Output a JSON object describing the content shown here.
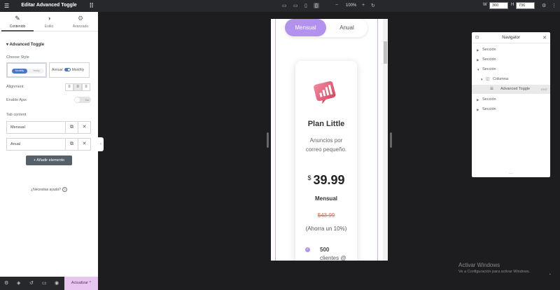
{
  "panel": {
    "title": "Editar Advanced Toggle",
    "tabs": [
      {
        "label": "Contenido",
        "icon": "pencil-icon"
      },
      {
        "label": "Estilo",
        "icon": "half-circle-icon"
      },
      {
        "label": "Avanzado",
        "icon": "gear-icon"
      }
    ],
    "section_title": "Advanced Toggle",
    "choose_style_label": "Choose Style",
    "style_option_1": {
      "on": "Monthly",
      "off": "Yearly"
    },
    "style_option_2": {
      "left": "Annual",
      "right": "Monthly"
    },
    "alignment_label": "Alignment",
    "enable_ajax_label": "Enable Ajax",
    "ajax_value": "No",
    "tab_content_label": "Tab content",
    "tab_items": [
      "Mensual",
      "Anual"
    ],
    "add_button": "Añadir elemento",
    "help_text": "¿Necesitas ayuda?",
    "update_button": "Actualizar"
  },
  "toolbar": {
    "zoom": "100%",
    "width_label": "W",
    "width_value": "360",
    "height_label": "H",
    "height_value": "736"
  },
  "preview": {
    "toggle": [
      "Mensual",
      "Anual"
    ],
    "plan_name": "Plan Little",
    "description": "Anuncios por correo pequeño.",
    "currency": "$",
    "price": "39.99",
    "period": "Mensual",
    "old_price": "$43.99",
    "savings": "(Ahorra un 10%)",
    "feature_bold": "500",
    "feature_text": "clientes @",
    "accent_color": "#b292ee"
  },
  "navigator": {
    "title": "Navigator",
    "rows": [
      "Sección",
      "Sección",
      "Sección",
      "Columna",
      "Advanced Toggle",
      "Sección",
      "Sección"
    ],
    "edit_tag": "EXIT"
  },
  "watermark": {
    "line1": "Activar Windows",
    "line2": "Ve a Configuración para activar Windows."
  }
}
